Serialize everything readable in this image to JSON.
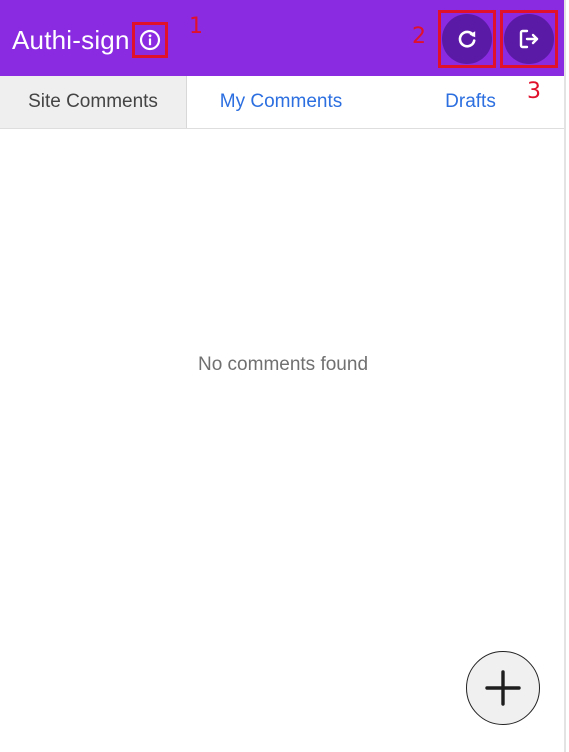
{
  "header": {
    "title": "Authi-sign",
    "background_color": "#8a2be2",
    "info_icon": "info-circle-icon",
    "refresh_icon": "refresh-icon",
    "logout_icon": "logout-icon"
  },
  "annotations": [
    "1",
    "2",
    "3"
  ],
  "tabs": [
    {
      "label": "Site Comments",
      "active": true
    },
    {
      "label": "My Comments",
      "active": false
    },
    {
      "label": "Drafts",
      "active": false
    }
  ],
  "main": {
    "empty_message": "No comments found"
  },
  "fab": {
    "icon": "plus-icon"
  },
  "colors": {
    "accent": "#8a2be2",
    "button_dark": "#5b1aa6",
    "link": "#2c6fe0",
    "annotation": "#e0112b"
  }
}
